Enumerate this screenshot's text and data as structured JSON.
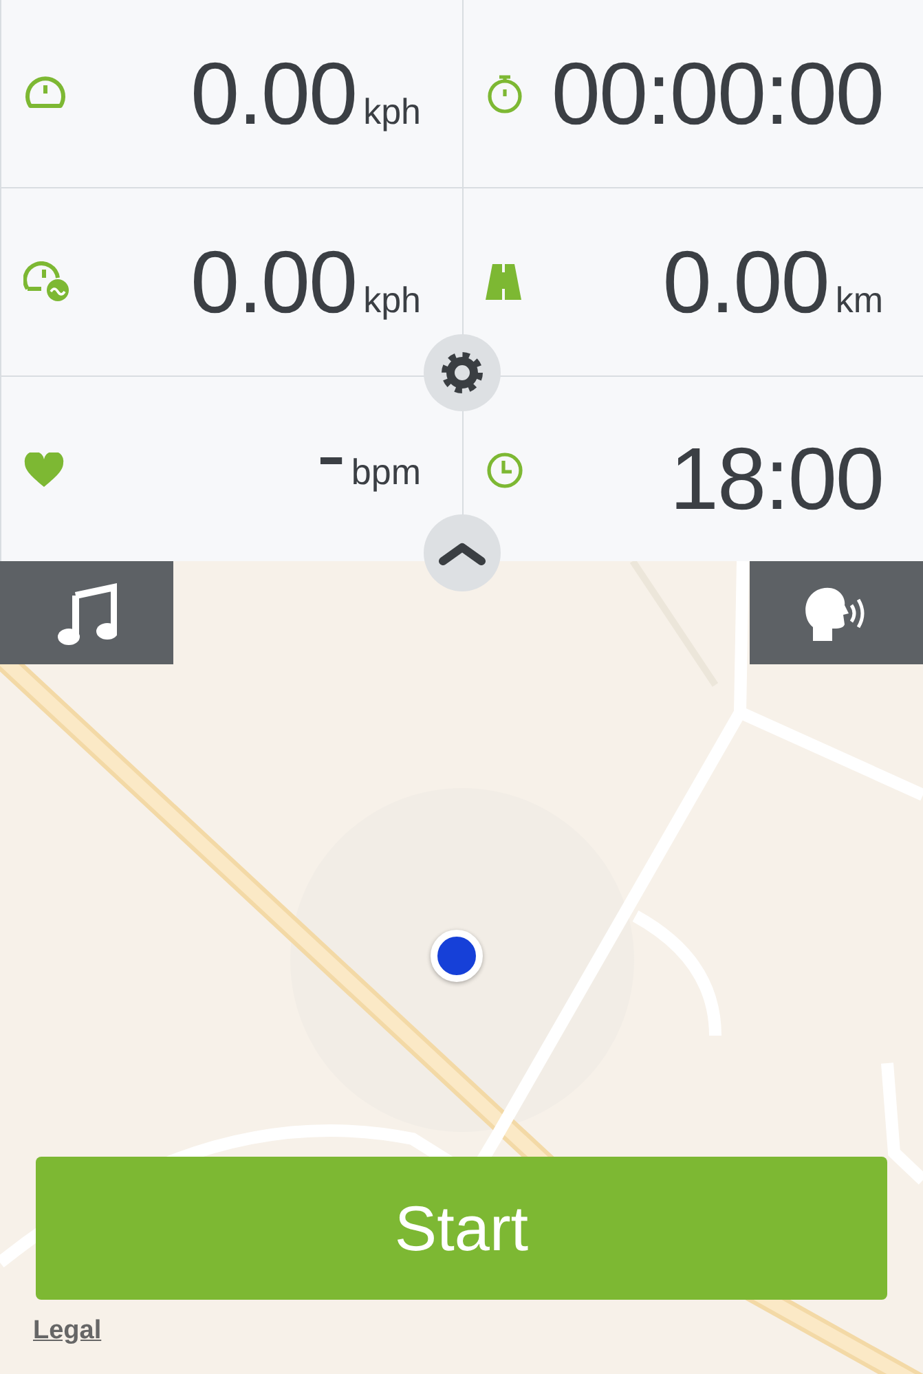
{
  "stats": [
    {
      "kind": "speed",
      "value": "0.00",
      "unit": "kph"
    },
    {
      "kind": "duration",
      "value": "00:00:00"
    },
    {
      "kind": "avg-speed",
      "value": "0.00",
      "unit": "kph"
    },
    {
      "kind": "distance",
      "value": "0.00",
      "unit": "km"
    },
    {
      "kind": "heart-rate",
      "value": "-",
      "unit": "bpm"
    },
    {
      "kind": "time",
      "value": "18:00"
    }
  ],
  "start_button": "Start",
  "legal_link": "Legal"
}
